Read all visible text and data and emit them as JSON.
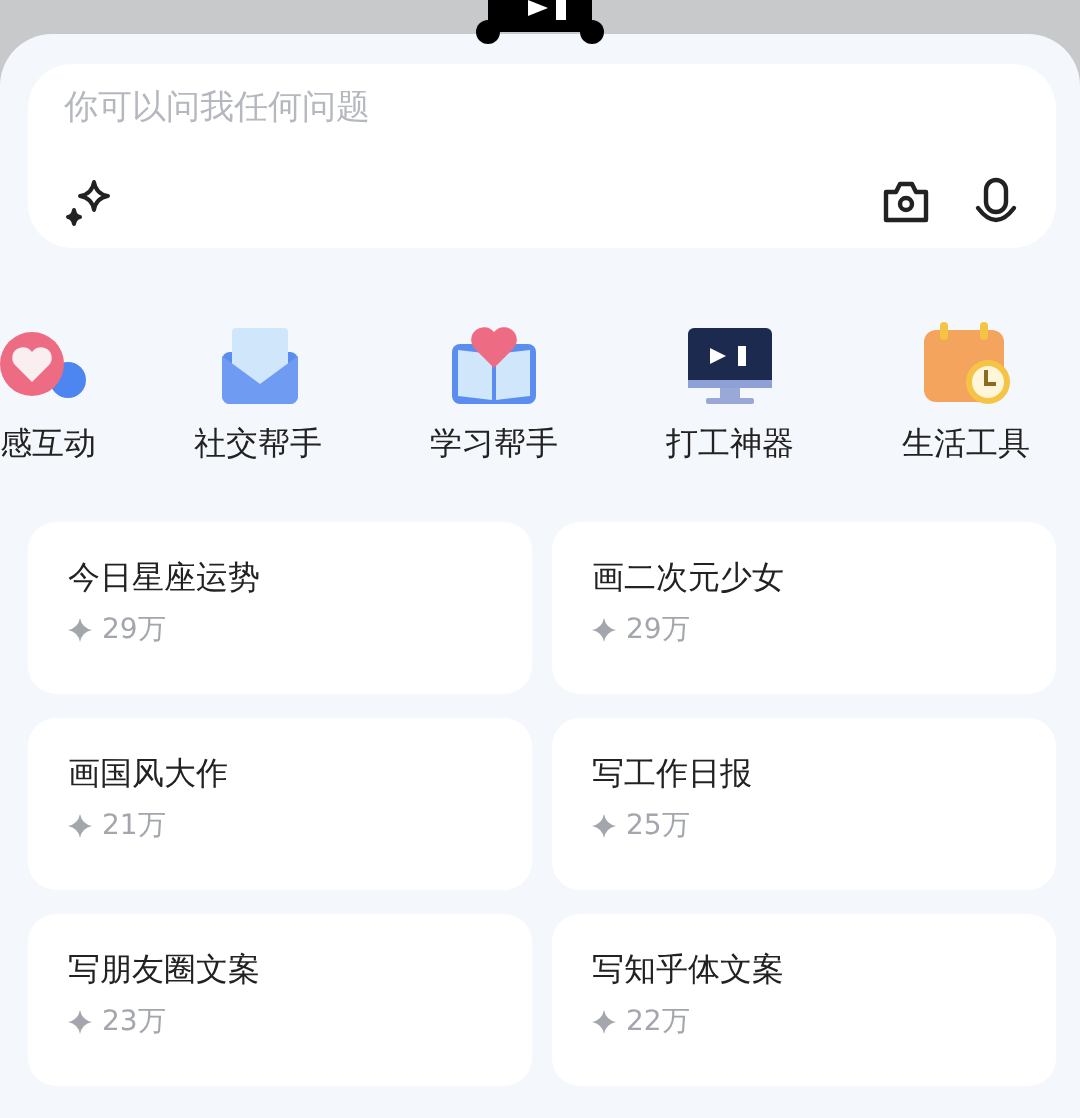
{
  "input": {
    "placeholder": "你可以问我任何问题"
  },
  "categories": [
    {
      "label": "感互动",
      "kind": "chat"
    },
    {
      "label": "社交帮手",
      "kind": "mail"
    },
    {
      "label": "学习帮手",
      "kind": "book"
    },
    {
      "label": "打工神器",
      "kind": "monitor"
    },
    {
      "label": "生活工具",
      "kind": "calendar"
    }
  ],
  "prompts": [
    {
      "title": "今日星座运势",
      "count": "29万"
    },
    {
      "title": "画二次元少女",
      "count": "29万"
    },
    {
      "title": "画国风大作",
      "count": "21万"
    },
    {
      "title": "写工作日报",
      "count": "25万"
    },
    {
      "title": "写朋友圈文案",
      "count": "23万"
    },
    {
      "title": "写知乎体文案",
      "count": "22万"
    }
  ]
}
